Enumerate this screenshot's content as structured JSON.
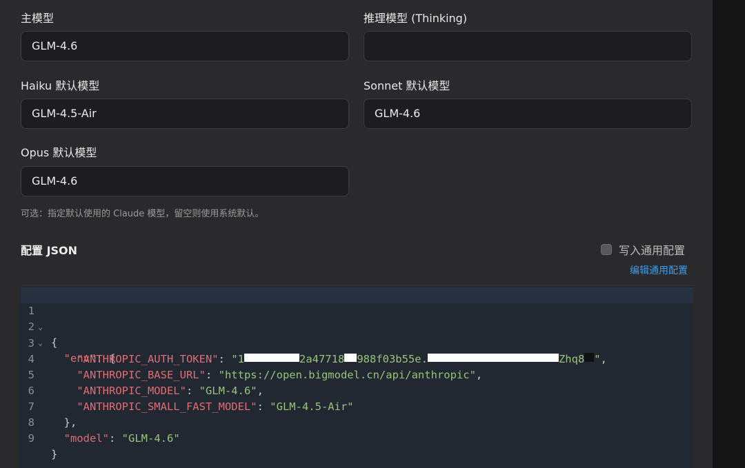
{
  "fields": {
    "main_model": {
      "label": "主模型",
      "value": "GLM-4.6"
    },
    "thinking_model": {
      "label": "推理模型 (Thinking)",
      "value": ""
    },
    "haiku_model": {
      "label": "Haiku 默认模型",
      "value": "GLM-4.5-Air"
    },
    "sonnet_model": {
      "label": "Sonnet 默认模型",
      "value": "GLM-4.6"
    },
    "opus_model": {
      "label": "Opus 默认模型",
      "value": "GLM-4.6"
    }
  },
  "hint": "可选：指定默认使用的 Claude 模型，留空则使用系统默认。",
  "config": {
    "title": "配置 JSON",
    "write_common_label": "写入通用配置",
    "write_common_checked": false,
    "edit_common_link": "编辑通用配置"
  },
  "editor": {
    "line_numbers": [
      "1",
      "2",
      "3",
      "4",
      "5",
      "6",
      "7",
      "8",
      "9"
    ],
    "fold_marker": "⌄",
    "brace_open": "{",
    "brace_close": "}",
    "env_key": "\"env\"",
    "env_close": "},",
    "auth_token_key": "\"ANTHROPIC_AUTH_TOKEN\"",
    "auth_token_value_start": "\"1",
    "auth_token_value_mid1": "2a47718",
    "auth_token_value_mid2": "988f03b55e.",
    "auth_token_value_end": "Zhq8",
    "base_url_key": "\"ANTHROPIC_BASE_URL\"",
    "base_url_value": "\"https://open.bigmodel.cn/api/anthropic\"",
    "model_key": "\"ANTHROPIC_MODEL\"",
    "model_value": "\"GLM-4.6\"",
    "small_fast_model_key": "\"ANTHROPIC_SMALL_FAST_MODEL\"",
    "small_fast_model_value": "\"GLM-4.5-Air\"",
    "root_model_key": "\"model\"",
    "root_model_value": "\"GLM-4.6\""
  },
  "colors": {
    "json_key": "#e06c75",
    "json_string": "#98c379",
    "link": "#3b9cf0"
  }
}
